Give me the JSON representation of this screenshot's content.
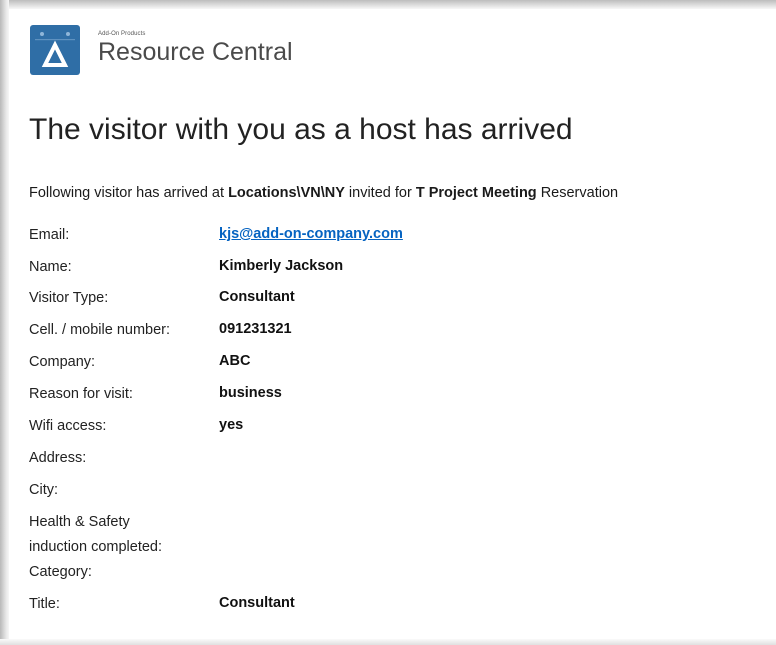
{
  "header": {
    "brand_small": "Add-On Products",
    "brand_name": "Resource Central",
    "logo_icon": "resource-central-logo-icon",
    "logo_color": "#2f6ea6"
  },
  "headline": "The visitor with you as a host has arrived",
  "intro": {
    "text_before_location": "Following visitor has arrived at ",
    "location": "Locations\\VN\\NY",
    "text_before_reservation": " invited for ",
    "reservation_name": "T Project Meeting",
    "text_after_reservation": " Reservation"
  },
  "fields": [
    {
      "label": "Email:",
      "value": "kjs@add-on-company.com"
    },
    {
      "label": "Name:",
      "value": "Kimberly Jackson"
    },
    {
      "label": "Visitor Type:",
      "value": "Consultant"
    },
    {
      "label": "Cell. / mobile number:",
      "value": "091231321"
    },
    {
      "label": "Company:",
      "value": "ABC"
    },
    {
      "label": "Reason for visit:",
      "value": "business"
    },
    {
      "label": "Wifi access:",
      "value": "yes"
    },
    {
      "label": "Address:",
      "value": ""
    },
    {
      "label": "City:",
      "value": ""
    },
    {
      "label": "Health & Safety",
      "value": ""
    },
    {
      "label": "induction completed:",
      "value": ""
    },
    {
      "label": "Category:",
      "value": ""
    },
    {
      "label": "Title:",
      "value": "Consultant"
    }
  ],
  "colors": {
    "link": "#0563c1",
    "text": "#1a1a1a"
  }
}
